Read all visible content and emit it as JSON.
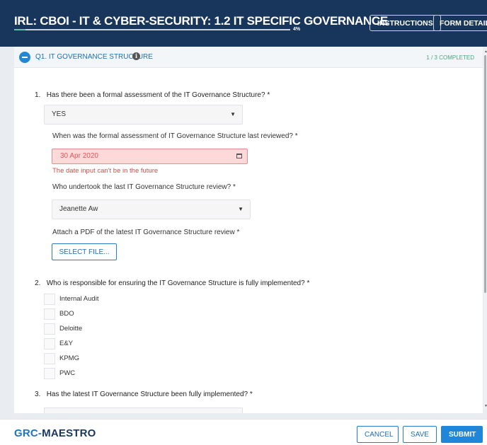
{
  "header": {
    "title": "IRL: CBOI - IT & CYBER-SECURITY: 1.2 IT SPECIFIC GOVERNANCE",
    "progress_label": "4%",
    "progress": 0.04,
    "instructions_label": "INSTRUCTIONS",
    "form_details_label": "FORM DETAILS"
  },
  "section": {
    "title": "Q1. IT GOVERNANCE STRUCTURE",
    "info_icon": "i",
    "completed": "1 / 3 COMPLETED"
  },
  "questions": [
    {
      "number": "1.",
      "text": "Has there been a formal assessment of the IT Governance Structure? *",
      "answer": "YES",
      "sub": {
        "review_date_label": "When was the formal assessment of IT Governance Structure last reviewed? *",
        "review_date_value": "30 Apr 2020",
        "review_date_error": "The date input can't be in the future",
        "reviewer_label": "Who undertook the last IT Governance Structure review? *",
        "reviewer_value": "Jeanette Aw",
        "attach_label": "Attach a PDF of the latest IT Governance Structure review *",
        "select_file_label": "SELECT FILE..."
      }
    },
    {
      "number": "2.",
      "text": "Who is responsible for ensuring the IT Governance Structure is fully implemented? *",
      "options": [
        "Internal Audit",
        "BDO",
        "Deloitte",
        "E&Y",
        "KPMG",
        "PWC"
      ]
    },
    {
      "number": "3.",
      "text": "Has the latest IT Governance Structure been fully implemented? *"
    }
  ],
  "footer": {
    "brand_prefix": "GRC-",
    "brand_suffix": "MAESTRO",
    "cancel_label": "CANCEL",
    "save_label": "SAVE",
    "submit_label": "SUBMIT"
  },
  "colors": {
    "header_bg": "#18365b",
    "accent": "#1f86d9",
    "error": "#e04848",
    "completed": "#4aa57d"
  }
}
